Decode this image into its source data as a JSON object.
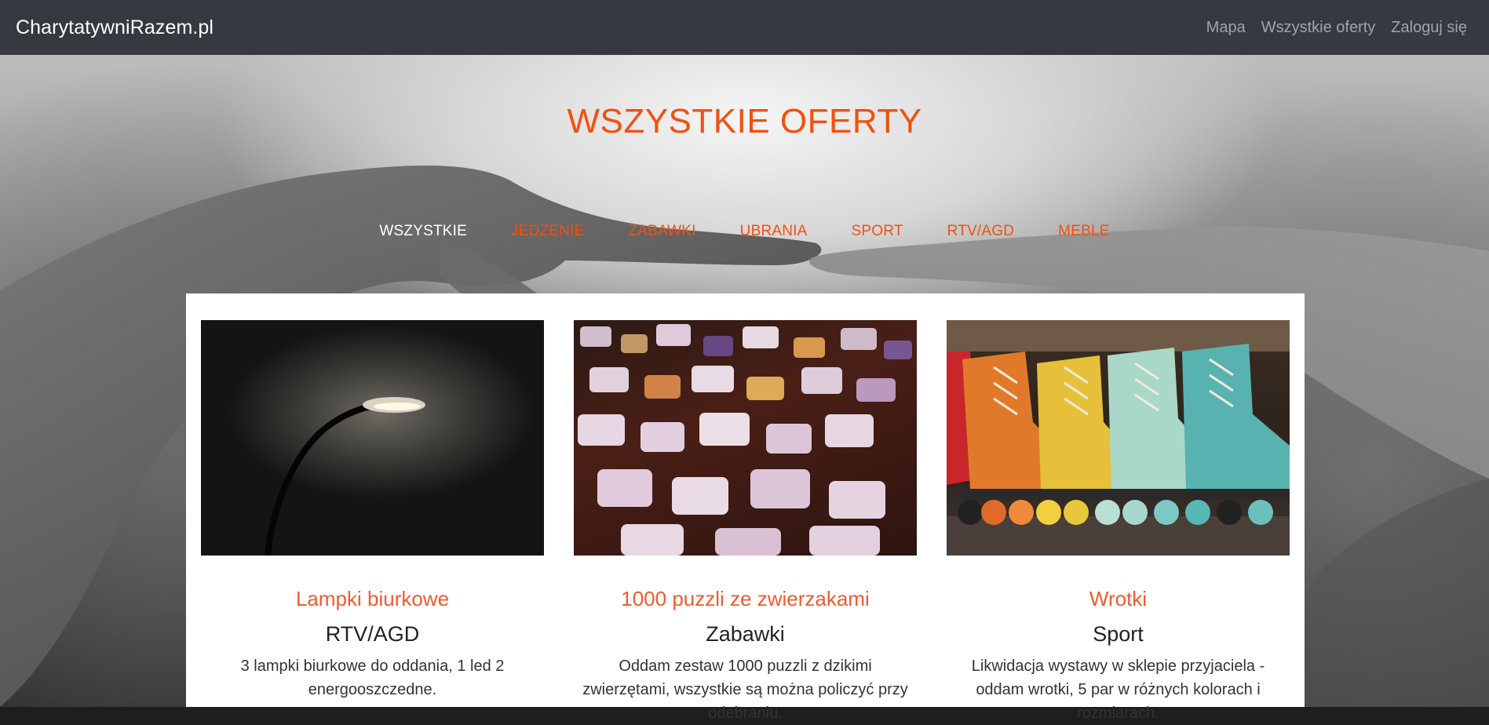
{
  "navbar": {
    "brand": "CharytatywniRazem.pl",
    "links": [
      "Mapa",
      "Wszystkie oferty",
      "Zaloguj się"
    ]
  },
  "hero": {
    "title": "WSZYSTKIE OFERTY"
  },
  "filters": [
    {
      "label": "WSZYSTKIE",
      "active": true
    },
    {
      "label": "JEDZENIE",
      "active": false
    },
    {
      "label": "ZABAWKI",
      "active": false
    },
    {
      "label": "UBRANIA",
      "active": false
    },
    {
      "label": "SPORT",
      "active": false
    },
    {
      "label": "RTV/AGD",
      "active": false
    },
    {
      "label": "MEBLE",
      "active": false
    }
  ],
  "offers": [
    {
      "title": "Lampki biurkowe",
      "category": "RTV/AGD",
      "description": "3 lampki biurkowe do oddania, 1 led 2 energooszczedne.",
      "image": "desk-lamp-photo"
    },
    {
      "title": "1000 puzzli ze zwierzakami",
      "category": "Zabawki",
      "description": "Oddam zestaw 1000 puzzli z dzikimi zwierzętami, wszystkie są można policzyć przy odebraniu.",
      "image": "puzzle-pieces-photo"
    },
    {
      "title": "Wrotki",
      "category": "Sport",
      "description": "Likwidacja wystawy w sklepie przyjaciela - oddam wrotki, 5 par w różnych kolorach i rozmiarach.",
      "image": "roller-skates-photo"
    }
  ],
  "colors": {
    "navbar_bg": "#343a40",
    "accent": "#f2500f",
    "card_title": "#f05a2f"
  }
}
